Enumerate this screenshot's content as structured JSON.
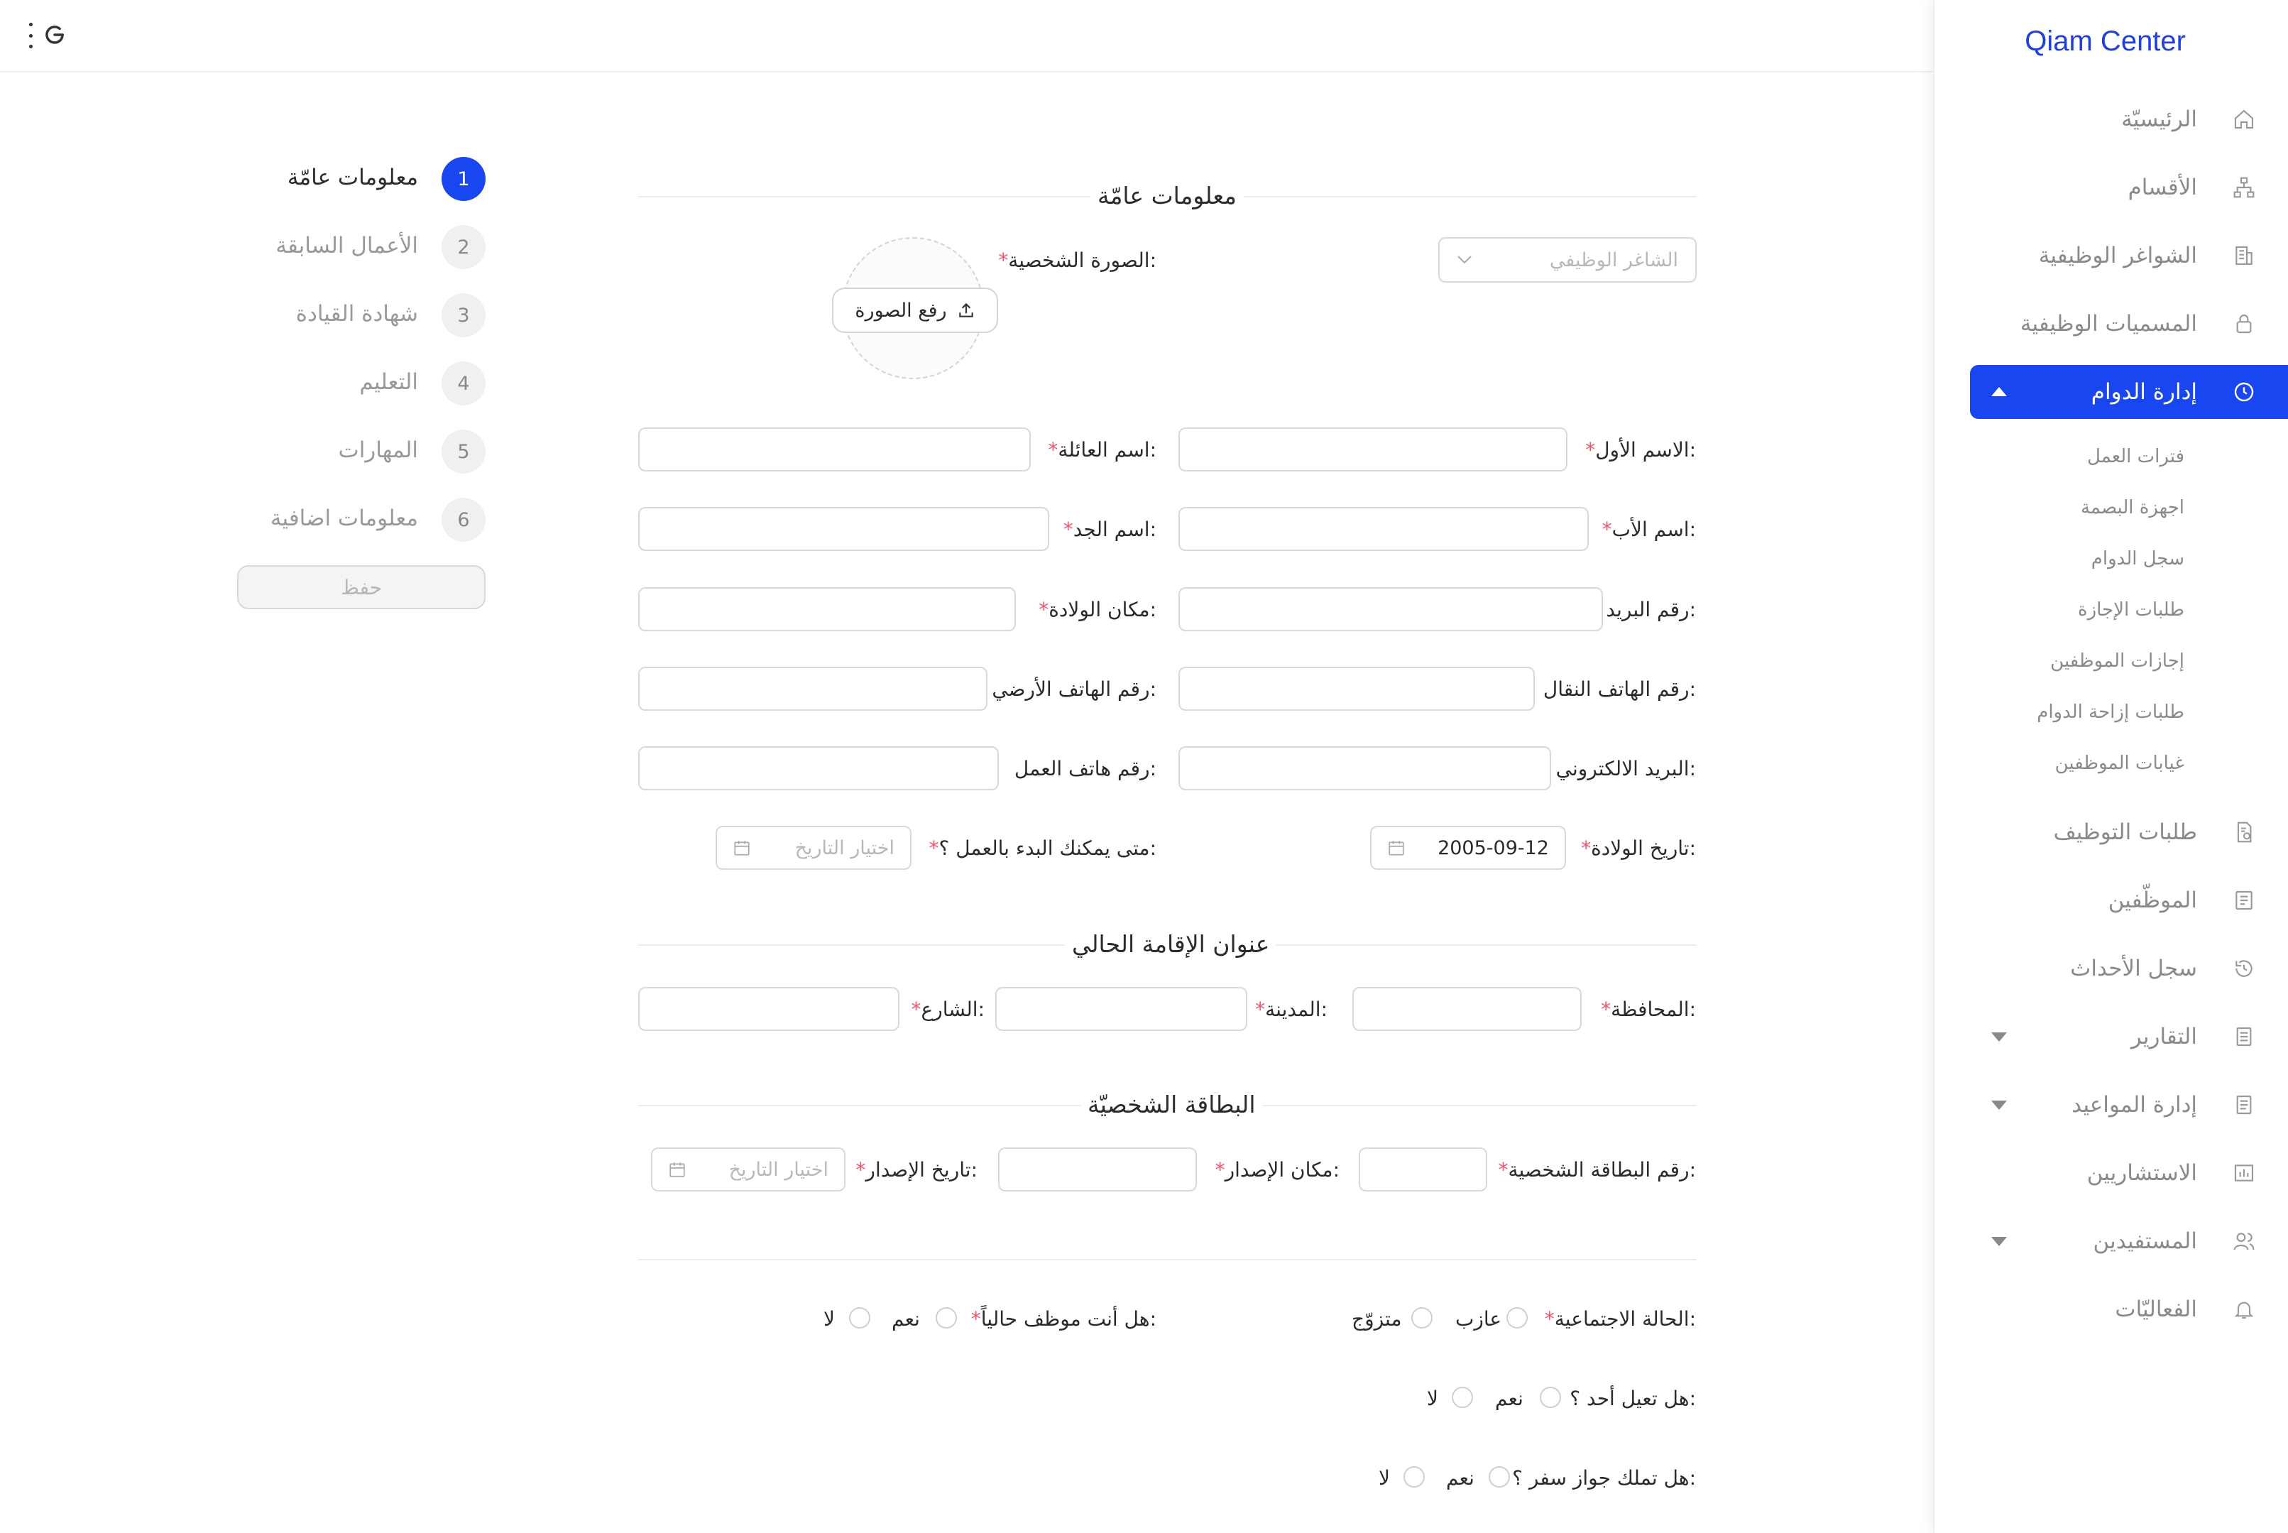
{
  "sidebar": {
    "brand": "Qiam Center",
    "items": [
      {
        "label": "الرئيسيّة",
        "icon": "home-icon"
      },
      {
        "label": "الأقسام",
        "icon": "sitemap-icon"
      },
      {
        "label": "الشواغر الوظيفية",
        "icon": "building-icon"
      },
      {
        "label": "المسميات الوظيفية",
        "icon": "lock-icon"
      },
      {
        "label": "إدارة الدوام",
        "icon": "clock-icon",
        "active": true
      },
      {
        "label": "طلبات التوظيف",
        "icon": "document-check-icon"
      },
      {
        "label": "الموظّفين",
        "icon": "id-card-icon"
      },
      {
        "label": "سجل الأحداث",
        "icon": "history-icon"
      },
      {
        "label": "التقارير",
        "icon": "report-icon"
      },
      {
        "label": "إدارة المواعيد",
        "icon": "appointments-icon"
      },
      {
        "label": "الاستشاريين",
        "icon": "chart-icon"
      },
      {
        "label": "المستفيدين",
        "icon": "users-icon"
      },
      {
        "label": "الفعاليّات",
        "icon": "bell-icon"
      }
    ],
    "subitems": [
      "فترات العمل",
      "اجهزة البصمة",
      "سجل الدوام",
      "طلبات الإجازة",
      "إجازات الموظفين",
      "طلبات إزاحة الدوام",
      "غيابات الموظفين"
    ]
  },
  "steps": [
    {
      "num": "1",
      "label": "معلومات عامّة"
    },
    {
      "num": "2",
      "label": "الأعمال السابقة"
    },
    {
      "num": "3",
      "label": "شهادة القيادة"
    },
    {
      "num": "4",
      "label": "التعليم"
    },
    {
      "num": "5",
      "label": "المهارات"
    },
    {
      "num": "6",
      "label": "معلومات اضافية"
    }
  ],
  "save_label": "حفظ",
  "form": {
    "section_general": "معلومات عامّة",
    "vacancy_placeholder": "الشاغر الوظيفي",
    "photo_label": "الصورة الشخصية:",
    "upload_label": "رفع الصورة",
    "first_name": "الاسم الأول:",
    "family_name": "اسم العائلة:",
    "father_name": "اسم الأب:",
    "grandfather_name": "اسم الجد:",
    "postal_code": "رقم البريد:",
    "birth_place": "مكان الولادة:",
    "mobile": "رقم الهاتف النقال:",
    "landline": "رقم الهاتف الأرضي:",
    "email": "البريد الالكتروني:",
    "work_phone": "رقم هاتف العمل:",
    "birth_date": "تاريخ الولادة:",
    "birth_date_value": "2005-09-12",
    "start_work": "متى يمكنك البدء بالعمل ؟:",
    "date_placeholder": "اختيار التاريخ",
    "section_address": "عنوان الإقامة الحالي",
    "governorate": "المحافظة:",
    "city": "المدينة:",
    "street": "الشارع:",
    "section_id": "البطاقة الشخصيّة",
    "id_number": "رقم البطاقة الشخصية:",
    "issue_place": "مكان الإصدار:",
    "issue_date": "تاريخ الإصدار:",
    "marital_status": "الحالة الاجتماعية:",
    "single": "عازب",
    "married": "متزوّج",
    "employed_q": "هل أنت موظف حالياً:",
    "yes": "نعم",
    "no": "لا",
    "supports_q": "هل تعيل أحد ؟:",
    "passport_q": "هل تملك جواز سفر ؟:"
  }
}
